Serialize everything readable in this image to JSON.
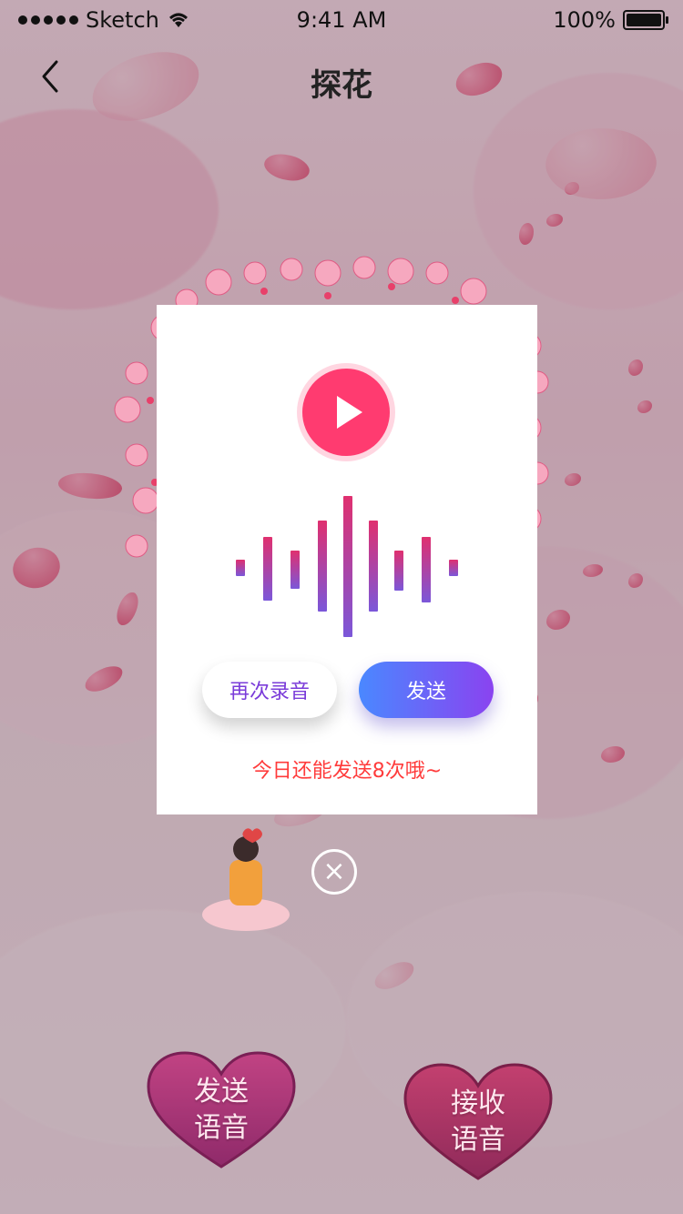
{
  "status_bar": {
    "carrier": "Sketch",
    "time": "9:41 AM",
    "battery": "100%"
  },
  "nav": {
    "title": "探花"
  },
  "modal": {
    "retry_label": "再次录音",
    "send_label": "发送",
    "hint": "今日还能发送8次哦~"
  },
  "bottom": {
    "send_voice_label": "发送\n语音",
    "receive_voice_label": "接收\n语音"
  },
  "icons": [
    "back-chevron-icon",
    "wifi-icon",
    "battery-icon",
    "play-icon",
    "close-icon",
    "heart-icon",
    "waveform-icon"
  ],
  "colors": {
    "accent": "#ff3b70",
    "send_gradient_start": "#4a88ff",
    "send_gradient_end": "#8a43f0",
    "hint": "#ff3b3b"
  }
}
